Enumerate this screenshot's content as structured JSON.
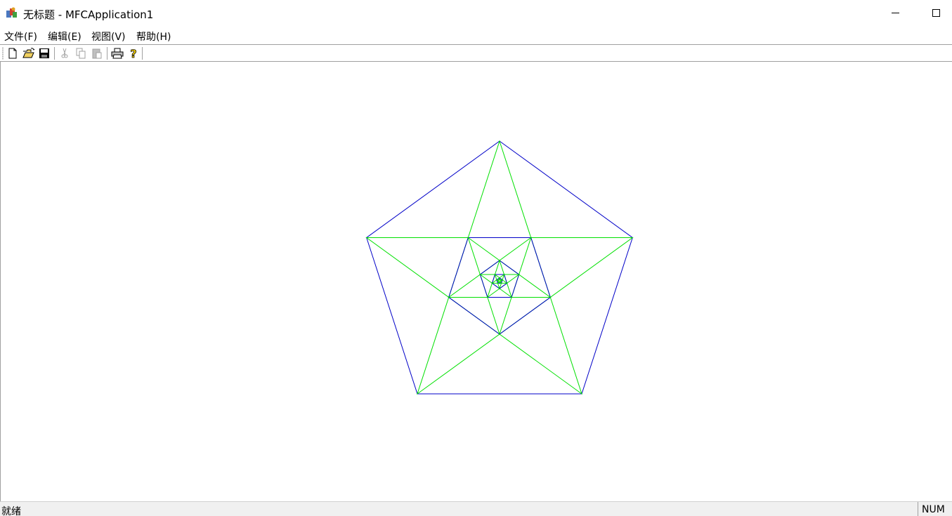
{
  "window": {
    "title": "无标题 - MFCApplication1"
  },
  "menu": {
    "items": [
      {
        "label": "文件(F)"
      },
      {
        "label": "编辑(E)"
      },
      {
        "label": "视图(V)"
      },
      {
        "label": "帮助(H)"
      }
    ]
  },
  "toolbar": {
    "buttons": [
      {
        "icon": "new-file-icon",
        "enabled": true
      },
      {
        "icon": "open-folder-icon",
        "enabled": true
      },
      {
        "icon": "save-icon",
        "enabled": true
      },
      {
        "icon": "cut-icon",
        "enabled": false
      },
      {
        "icon": "copy-icon",
        "enabled": false
      },
      {
        "icon": "paste-icon",
        "enabled": false
      },
      {
        "icon": "print-icon",
        "enabled": true
      },
      {
        "icon": "help-icon",
        "enabled": true
      }
    ]
  },
  "drawing": {
    "colors": {
      "pentagon": "#0000c8",
      "star": "#00e000"
    }
  },
  "status": {
    "text": "就绪",
    "num": "NUM"
  }
}
